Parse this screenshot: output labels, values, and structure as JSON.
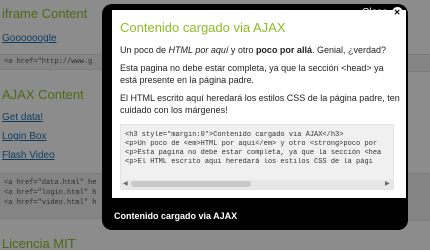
{
  "background": {
    "headings": [
      "iframe Content",
      "AJAX Content",
      "Licencia MIT"
    ],
    "links": [
      "Goooooogle",
      "Get data!",
      "Login Box",
      "Flash Video"
    ],
    "code_lines_1": [
      "<a href=\"http://www.g"
    ],
    "code_lines_2": [
      "<a href=\"data.html\" he",
      "<a href=\"login.html\" h",
      "<a href=\"video.html\" h"
    ]
  },
  "modal": {
    "title": "Contenido cargado via AJAX",
    "p1_a": "Un poco de ",
    "p1_b": "HTML por aquí",
    "p1_c": " y otro ",
    "p1_d": "poco por allá",
    "p1_e": ". Genial, ¿verdad?",
    "p2": "Esta pagina no debe estar completa, ya que la sección <head> ya está presente en la página padre.",
    "p3": "El HTML escrito aquí heredará los estilos CSS de la página padre, ten cuidado con los márgenes!",
    "code_lines": [
      "<h3 style=\"margin:0\">Contenido cargado via AJAX</h3>",
      "<p>Un poco de <em>HTML por aquí</em> y otro <strong>poco por",
      "<p>Esta pagina no debe estar completa, ya que la sección <hea",
      "<p>El HTML escrito aquí heredará los estilos CSS de la pági"
    ],
    "caption": "Contenido cargado via AJAX"
  },
  "close": {
    "label": "Close"
  }
}
